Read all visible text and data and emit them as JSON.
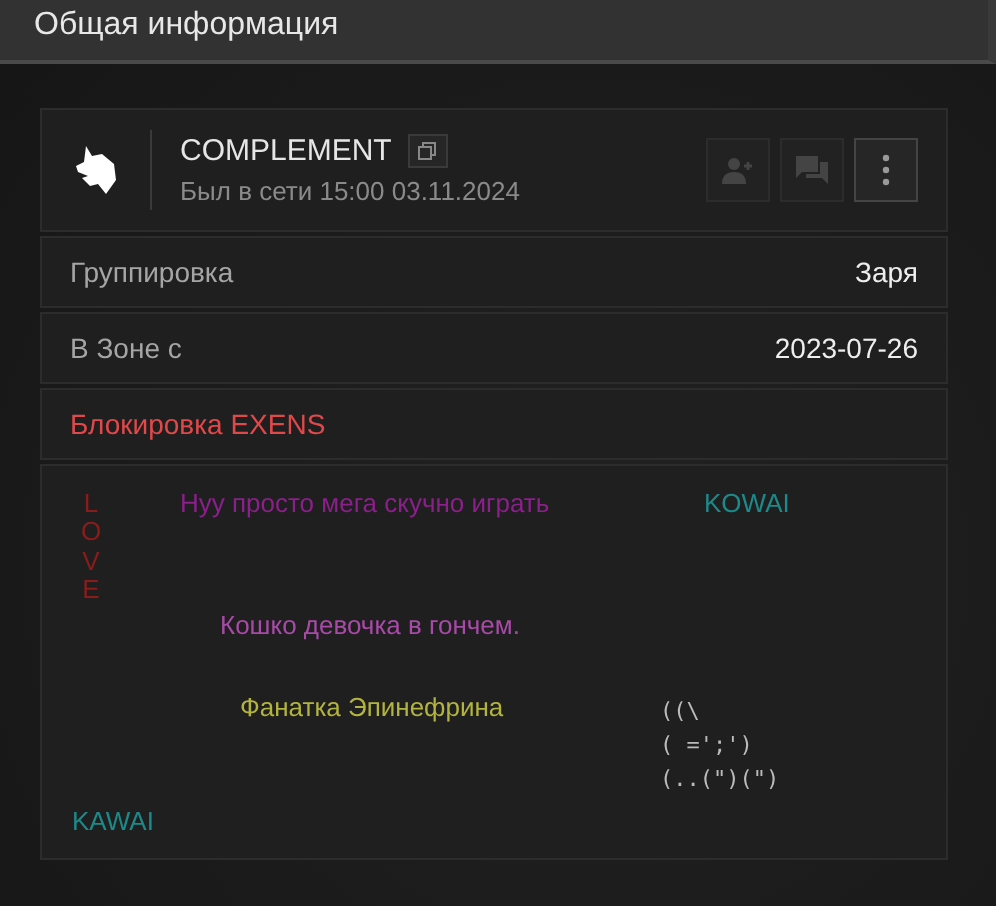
{
  "header": {
    "title": "Общая информация"
  },
  "profile": {
    "name": "COMPLEMENT",
    "last_seen": "Был в сети 15:00 03.11.2024"
  },
  "fields": [
    {
      "label": "Группировка",
      "value": "Заря"
    },
    {
      "label": "В Зоне с",
      "value": "2023-07-26"
    }
  ],
  "ban": {
    "text": "Блокировка EXENS"
  },
  "bio": [
    {
      "kind": "vertical",
      "text": "LOVE",
      "color": "#8a1c1c"
    },
    {
      "kind": "text",
      "text": "Нуу просто мега скучно играть",
      "color": "#8c1f8c"
    },
    {
      "kind": "text",
      "text": "KOWAI",
      "color": "#1c8a8a"
    },
    {
      "kind": "text",
      "text": "Кошко девочка в гончем.",
      "color": "#a84aa8"
    },
    {
      "kind": "text",
      "text": "Фанатка Эпинефрина",
      "color": "#b3b33f"
    },
    {
      "kind": "lines",
      "lines": [
        "((\\",
        "( =';')",
        "(..(\")(\")"
      ],
      "color": "#bbbbbb"
    },
    {
      "kind": "text",
      "text": "KAWAI",
      "color": "#1c8a8a"
    }
  ]
}
